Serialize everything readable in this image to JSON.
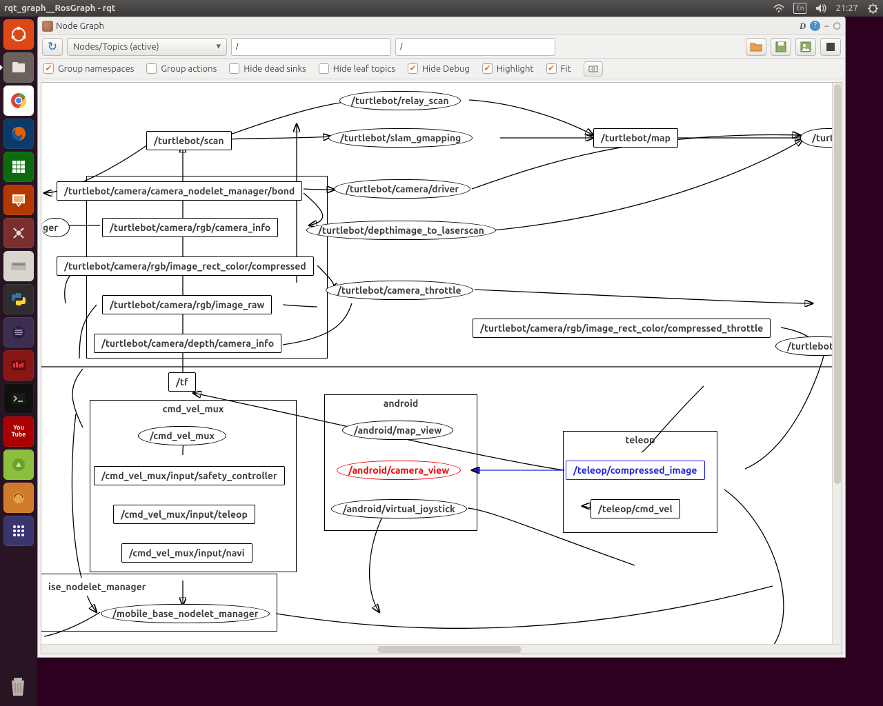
{
  "panel": {
    "title": "rqt_graph__RosGraph - rqt",
    "tray": {
      "lang": "En",
      "time": "21:27"
    }
  },
  "window": {
    "title": "Node Graph",
    "ctrl": {
      "d": "D",
      "help": "?",
      "min": "–",
      "close": "○"
    }
  },
  "toolbar": {
    "refresh_icon": "↻",
    "mode_select": "Nodes/Topics (active)",
    "filter1": "/",
    "filter2": "/",
    "icons": {
      "open": "open-icon",
      "save": "save-icon",
      "image": "image-icon",
      "settings": "settings-icon"
    }
  },
  "options": {
    "group_namespaces": {
      "label": "Group namespaces",
      "checked": true
    },
    "group_actions": {
      "label": "Group actions",
      "checked": false
    },
    "hide_dead_sinks": {
      "label": "Hide dead sinks",
      "checked": false
    },
    "hide_leaf_topics": {
      "label": "Hide leaf topics",
      "checked": false
    },
    "hide_debug": {
      "label": "Hide Debug",
      "checked": true
    },
    "highlight": {
      "label": "Highlight",
      "checked": true
    },
    "fit": {
      "label": "Fit",
      "checked": true
    }
  },
  "graph": {
    "nodes": {
      "relay_scan": "/turtlebot/relay_scan",
      "scan": "/turtlebot/scan",
      "slam_gmapping": "/turtlebot/slam_gmapping",
      "map": "/turtlebot/map",
      "turtl_cut": "/turtl",
      "bond": "/turtlebot/camera/camera_nodelet_manager/bond",
      "driver": "/turtlebot/camera/driver",
      "ger": "ger",
      "rgb_info": "/turtlebot/camera/rgb/camera_info",
      "depth2laser": "/turtlebot/depthimage_to_laserscan",
      "rect_compressed": "/turtlebot/camera/rgb/image_rect_color/compressed",
      "camera_throttle": "/turtlebot/camera_throttle",
      "image_raw": "/turtlebot/camera/rgb/image_raw",
      "depth_info": "/turtlebot/camera/depth/camera_info",
      "compressed_throttle": "/turtlebot/camera/rgb/image_rect_color/compressed_throttle",
      "turtlebot_r": "/turtlebot/r",
      "tf": "/tf",
      "cmd_vel_mux_group": "cmd_vel_mux",
      "cmd_vel_mux_node": "/cmd_vel_mux",
      "cmv_safety": "/cmd_vel_mux/input/safety_controller",
      "cmv_teleop": "/cmd_vel_mux/input/teleop",
      "cmv_navi": "/cmd_vel_mux/input/navi",
      "ise_mgr": "ise_nodelet_manager",
      "mobile_base": "/mobile_base_nodelet_manager",
      "android_group": "android",
      "android_map": "/android/map_view",
      "android_cam": "/android/camera_view",
      "android_joy": "/android/virtual_joystick",
      "teleop_group": "teleop",
      "teleop_img": "/teleop/compressed_image",
      "teleop_cmd": "/teleop/cmd_vel"
    }
  }
}
